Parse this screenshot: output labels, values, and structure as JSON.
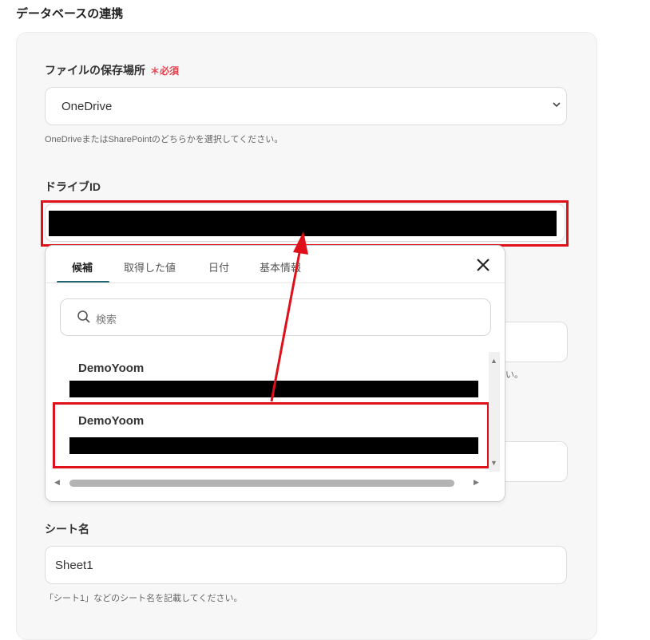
{
  "section": {
    "title": "データベースの連携"
  },
  "location": {
    "label": "ファイルの保存場所",
    "required_mark": "＊",
    "required_text": "必須",
    "value": "OneDrive",
    "help": "OneDriveまたはSharePointのどちらかを選択してください。"
  },
  "drive": {
    "label": "ドライブID"
  },
  "popup": {
    "tabs": [
      "候補",
      "取得した値",
      "日付",
      "基本情報"
    ],
    "active_tab": "候補",
    "search_placeholder": "検索",
    "items": [
      {
        "name": "DemoYoom"
      },
      {
        "name": "DemoYoom"
      }
    ]
  },
  "partial": {
    "fragment_1": "い。"
  },
  "sheet": {
    "label": "シート名",
    "value": "Sheet1",
    "help": "「シート1」などのシート名を記載してください。"
  },
  "colors": {
    "accent": "#21666e",
    "highlight": "#e0101a",
    "required": "#e8424d"
  }
}
